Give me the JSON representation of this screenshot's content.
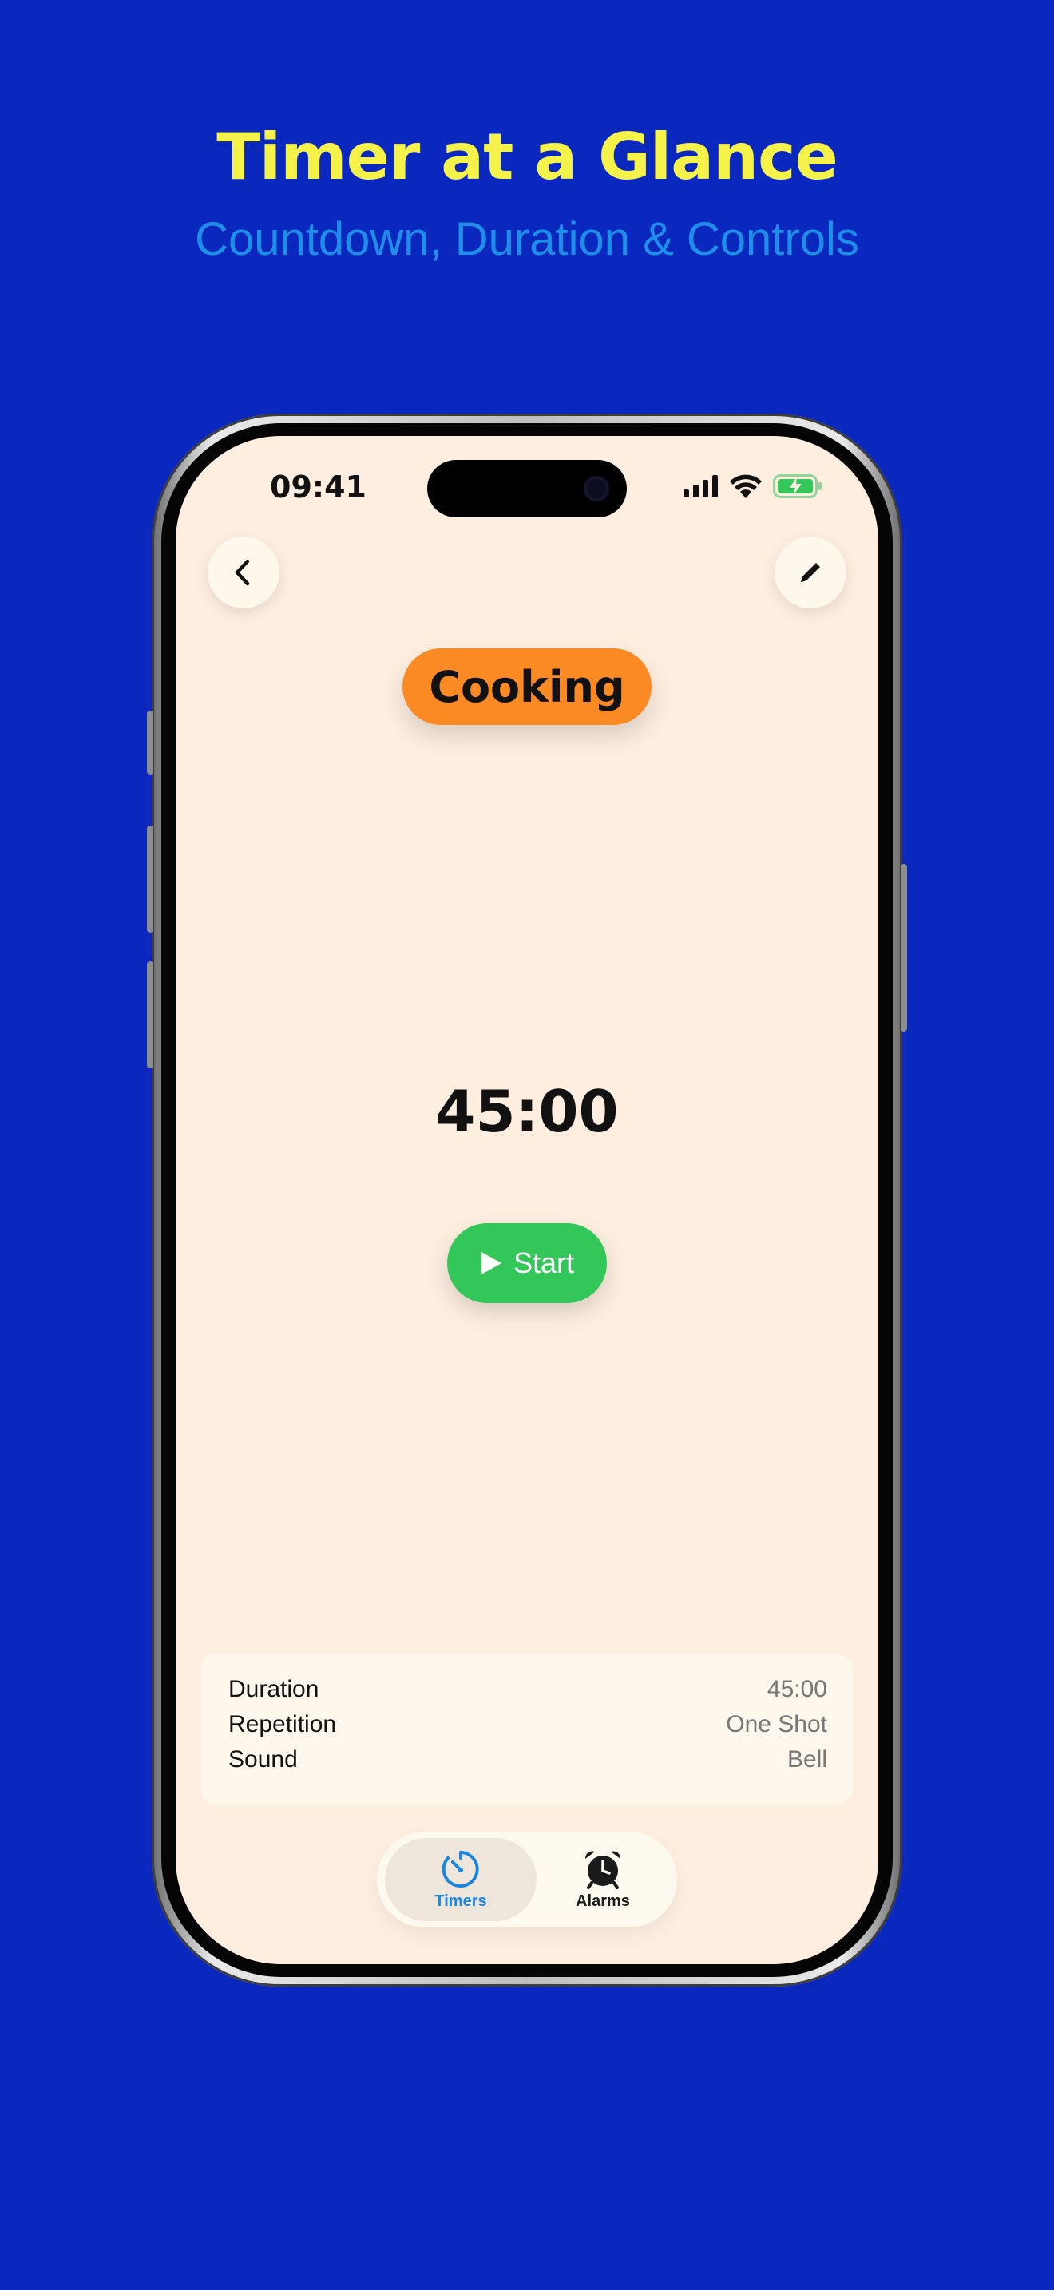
{
  "marketing": {
    "headline": "Timer at a Glance",
    "subheadline": "Countdown, Duration & Controls"
  },
  "status_bar": {
    "time": "09:41",
    "icons": [
      "cellular-signal-icon",
      "wifi-icon",
      "battery-charging-icon"
    ]
  },
  "nav": {
    "back_icon": "chevron-left-icon",
    "edit_icon": "pencil-icon"
  },
  "timer": {
    "category": "Cooking",
    "category_color": "#fc8a24",
    "remaining": "45:00",
    "start_label": "Start",
    "start_color": "#33c759"
  },
  "details": {
    "rows": [
      {
        "label": "Duration",
        "value": "45:00"
      },
      {
        "label": "Repetition",
        "value": "One Shot"
      },
      {
        "label": "Sound",
        "value": "Bell"
      }
    ]
  },
  "tabs": [
    {
      "label": "Timers",
      "icon": "timer-icon",
      "active": true
    },
    {
      "label": "Alarms",
      "icon": "alarm-clock-icon",
      "active": false
    }
  ],
  "colors": {
    "background": "#0a28be",
    "headline": "#f5f24a",
    "subheadline": "#1e8fe8",
    "screen": "#fdeee0",
    "accent": "#1a86e0"
  }
}
